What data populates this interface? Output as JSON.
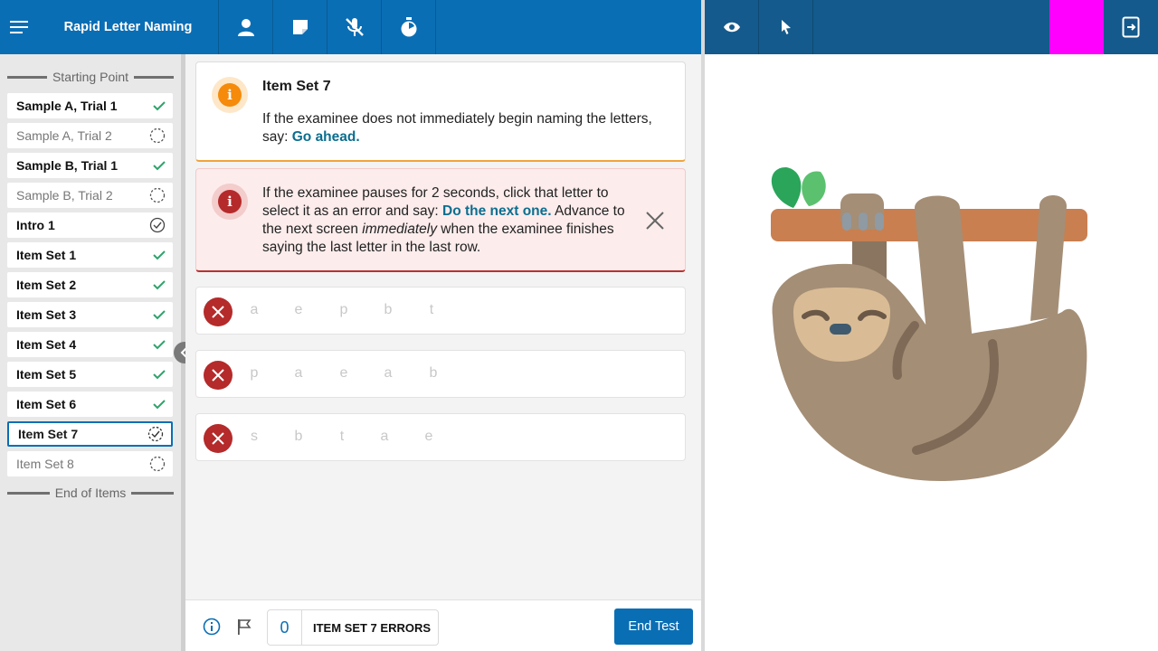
{
  "app": {
    "title": "Rapid Letter Naming"
  },
  "toolbar": {
    "menu_icon": "hamburger-icon",
    "icons": [
      "person-icon",
      "note-icon",
      "mic-off-icon",
      "timer-icon"
    ],
    "right_icons": [
      "eye-icon",
      "pointer-icon",
      "exit-screen-icon"
    ],
    "accent": "#ff00ff"
  },
  "sidebar": {
    "start_label": "Starting Point",
    "end_label": "End of Items",
    "items": [
      {
        "label": "Sample A, Trial 1",
        "status": "done"
      },
      {
        "label": "Sample A, Trial 2",
        "status": "pending"
      },
      {
        "label": "Sample B, Trial 1",
        "status": "done"
      },
      {
        "label": "Sample B, Trial 2",
        "status": "pending"
      },
      {
        "label": "Intro 1",
        "status": "visited"
      },
      {
        "label": "Item Set 1",
        "status": "done"
      },
      {
        "label": "Item Set 2",
        "status": "done"
      },
      {
        "label": "Item Set 3",
        "status": "done"
      },
      {
        "label": "Item Set 4",
        "status": "done"
      },
      {
        "label": "Item Set 5",
        "status": "done"
      },
      {
        "label": "Item Set 6",
        "status": "done"
      },
      {
        "label": "Item Set 7",
        "status": "current"
      },
      {
        "label": "Item Set 8",
        "status": "pending"
      }
    ]
  },
  "info_card": {
    "title": "Item Set 7",
    "text_before": "If the examinee does not immediately begin naming the letters, say: ",
    "text_highlight": "Go ahead."
  },
  "warn_card": {
    "text_1": "If the examinee pauses for 2 seconds, click that letter to select it as an error and say: ",
    "highlight": "Do the next one.",
    "text_2": " Advance to the next screen ",
    "emphasis": "immediately",
    "text_3": " when the examinee finishes saying the last letter in the last row."
  },
  "rows": [
    [
      "a",
      "e",
      "p",
      "b",
      "t"
    ],
    [
      "p",
      "a",
      "e",
      "a",
      "b"
    ],
    [
      "s",
      "b",
      "t",
      "a",
      "e"
    ]
  ],
  "footer": {
    "error_count": "0",
    "error_label": "ITEM SET 7 ERRORS",
    "end_button": "End Test"
  },
  "stimulus": {
    "image": "sloth-illustration"
  }
}
